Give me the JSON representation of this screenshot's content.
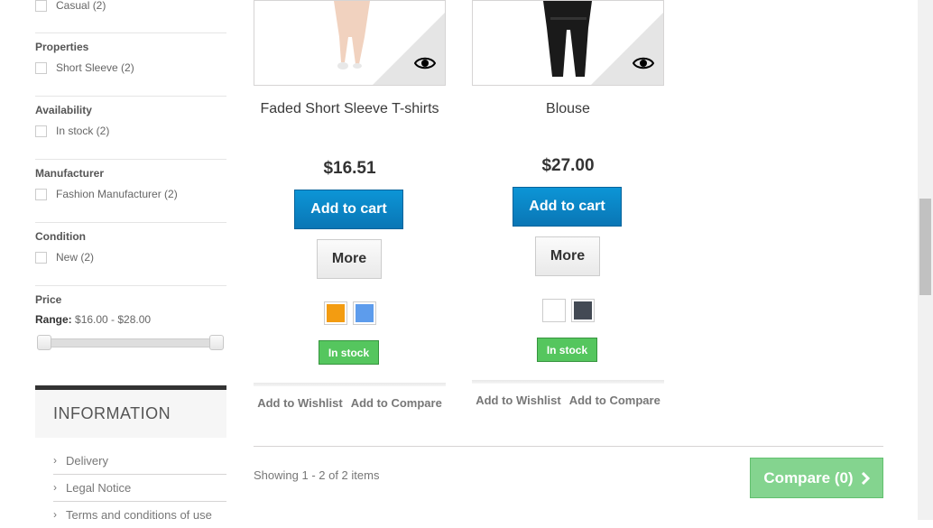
{
  "filters": {
    "top_partial": {
      "label": "Casual (2)"
    },
    "groups": [
      {
        "title": "Properties",
        "option": "Short Sleeve (2)"
      },
      {
        "title": "Availability",
        "option": "In stock (2)"
      },
      {
        "title": "Manufacturer",
        "option": "Fashion Manufacturer (2)"
      },
      {
        "title": "Condition",
        "option": "New (2)"
      }
    ],
    "price": {
      "title": "Price",
      "range_label": "Range:",
      "range_value": "$16.00 - $28.00"
    }
  },
  "information": {
    "title": "INFORMATION",
    "items": [
      "Delivery",
      "Legal Notice",
      "Terms and conditions of use"
    ]
  },
  "products": [
    {
      "name": "Faded Short Sleeve T-shirts",
      "price": "$16.51",
      "add_to_cart": "Add to cart",
      "more": "More",
      "colors": [
        "#f39c11",
        "#5d9cec"
      ],
      "stock": "In stock",
      "wishlist": "Add to Wishlist",
      "compare": "Add to Compare"
    },
    {
      "name": "Blouse",
      "price": "$27.00",
      "add_to_cart": "Add to cart",
      "more": "More",
      "colors": [
        "#ffffff",
        "#434a54"
      ],
      "stock": "In stock",
      "wishlist": "Add to Wishlist",
      "compare": "Add to Compare"
    }
  ],
  "footer": {
    "showing": "Showing 1 - 2 of 2 items",
    "compare_button": "Compare (0)"
  },
  "icons": {
    "quick_view": "eye-icon",
    "compare_arrow": "chevron-right-icon",
    "info_bullet": "chevron-right-icon"
  },
  "colors": {
    "cart_button": "#0a84c6",
    "stock_badge": "#55c65e",
    "compare_button": "#7ed28a"
  }
}
